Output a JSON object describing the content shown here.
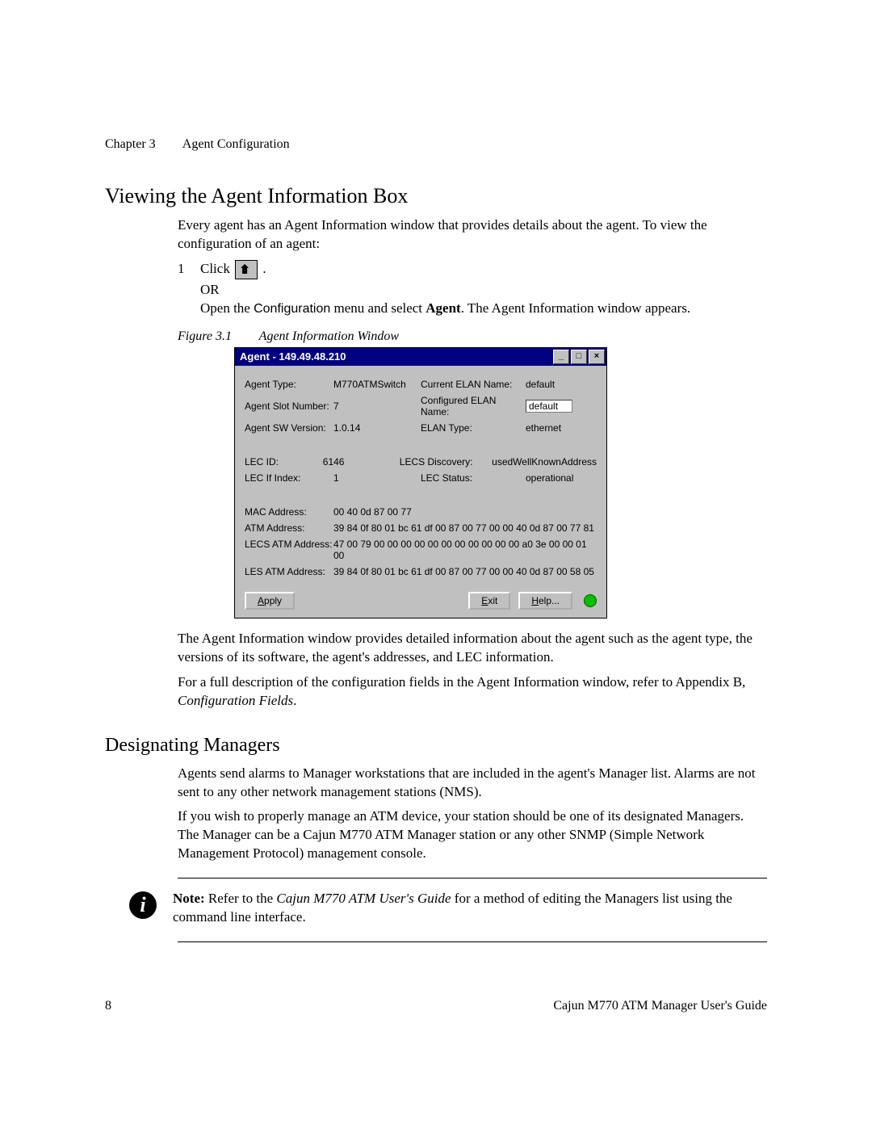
{
  "header": {
    "chapter": "Chapter 3",
    "title": "Agent Configuration"
  },
  "section1": {
    "heading": "Viewing the Agent Information Box",
    "intro": "Every agent has an Agent Information window that provides details about the agent. To view the configuration of an agent:",
    "step_num": "1",
    "step_click": "Click",
    "step_period": ".",
    "or": "OR",
    "open_pre": "Open the ",
    "open_config": "Configuration",
    "open_mid": " menu and select ",
    "open_agent": "Agent",
    "open_post": ". The Agent Information window appears.",
    "figure_num": "Figure 3.1",
    "figure_title": "Agent Information Window"
  },
  "agent_window": {
    "title": "Agent - 149.49.48.210",
    "labels": {
      "agent_type": "Agent Type:",
      "agent_slot": "Agent Slot Number:",
      "agent_sw": "Agent SW Version:",
      "current_elan": "Current ELAN Name:",
      "configured_elan": "Configured ELAN Name:",
      "elan_type": "ELAN Type:",
      "lec_id": "LEC ID:",
      "lec_if": "LEC If Index:",
      "lecs_discovery": "LECS Discovery:",
      "lec_status": "LEC Status:",
      "mac_addr": "MAC Address:",
      "atm_addr": "ATM Address:",
      "lecs_atm": "LECS ATM Address:",
      "les_atm": "LES ATM Address:"
    },
    "values": {
      "agent_type": "M770ATMSwitch",
      "agent_slot": "7",
      "agent_sw": "1.0.14",
      "current_elan": "default",
      "configured_elan": "default",
      "elan_type": "ethernet",
      "lec_id": "6146",
      "lec_if": "1",
      "lecs_discovery": "usedWellKnownAddress",
      "lec_status": "operational",
      "mac_addr": "00 40 0d 87 00 77",
      "atm_addr": "39 84 0f 80 01 bc 61 df 00 87 00 77 00 00 40 0d 87 00 77 81",
      "lecs_atm": "47 00 79 00 00 00 00 00 00 00 00 00 00 00 a0 3e 00 00 01 00",
      "les_atm": "39 84 0f 80 01 bc 61 df 00 87 00 77 00 00 40 0d 87 00 58 05"
    },
    "buttons": {
      "apply_pre": "A",
      "apply_post": "pply",
      "exit_pre": "E",
      "exit_post": "xit",
      "help_pre": "H",
      "help_post": "elp..."
    }
  },
  "after_figure": {
    "p1": "The Agent Information window provides detailed information about the agent such as the agent type, the versions of its software, the agent's addresses, and LEC information.",
    "p2a": "For a full description of the configuration fields in the Agent Information window, refer to Appendix B, ",
    "p2b": "Configuration Fields",
    "p2c": "."
  },
  "section2": {
    "heading": "Designating Managers",
    "p1": "Agents send alarms to Manager workstations that are included in the agent's Manager list. Alarms are not sent to any other network management stations (NMS).",
    "p2": "If you wish to properly manage an ATM device, your station should be one of its designated Managers. The Manager can be a Cajun M770 ATM Manager station or any other SNMP (Simple Network Management Protocol) management console."
  },
  "note": {
    "label": "Note:",
    "pre": "  Refer to the ",
    "italic": "Cajun M770 ATM User's Guide",
    "post1": " for a method of editing the Managers list using the command line interface."
  },
  "footer": {
    "page": "8",
    "book": "Cajun M770 ATM Manager User's Guide"
  }
}
